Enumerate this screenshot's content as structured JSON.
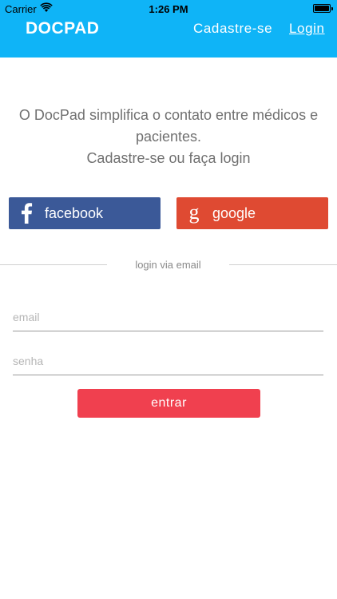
{
  "status_bar": {
    "carrier": "Carrier",
    "time": "1:26 PM",
    "battery_level": 1.0
  },
  "header": {
    "logo": "DOCPAD",
    "register_label": "Cadastre-se",
    "login_label": "Login",
    "background_color": "#0fb4f7"
  },
  "intro": {
    "line1": "O DocPad simplifica o contato entre médicos e pacientes.",
    "line2": "Cadastre-se ou faça login"
  },
  "social": {
    "facebook_label": "facebook",
    "facebook_icon": "facebook-f-icon",
    "facebook_color": "#3b5998",
    "google_label": "google",
    "google_icon": "google-g-icon",
    "google_color": "#df4a32"
  },
  "divider": {
    "label": "login via email"
  },
  "form": {
    "email_placeholder": "email",
    "email_value": "",
    "password_placeholder": "senha",
    "password_value": "",
    "submit_label": "entrar",
    "submit_color": "#f0404f"
  }
}
